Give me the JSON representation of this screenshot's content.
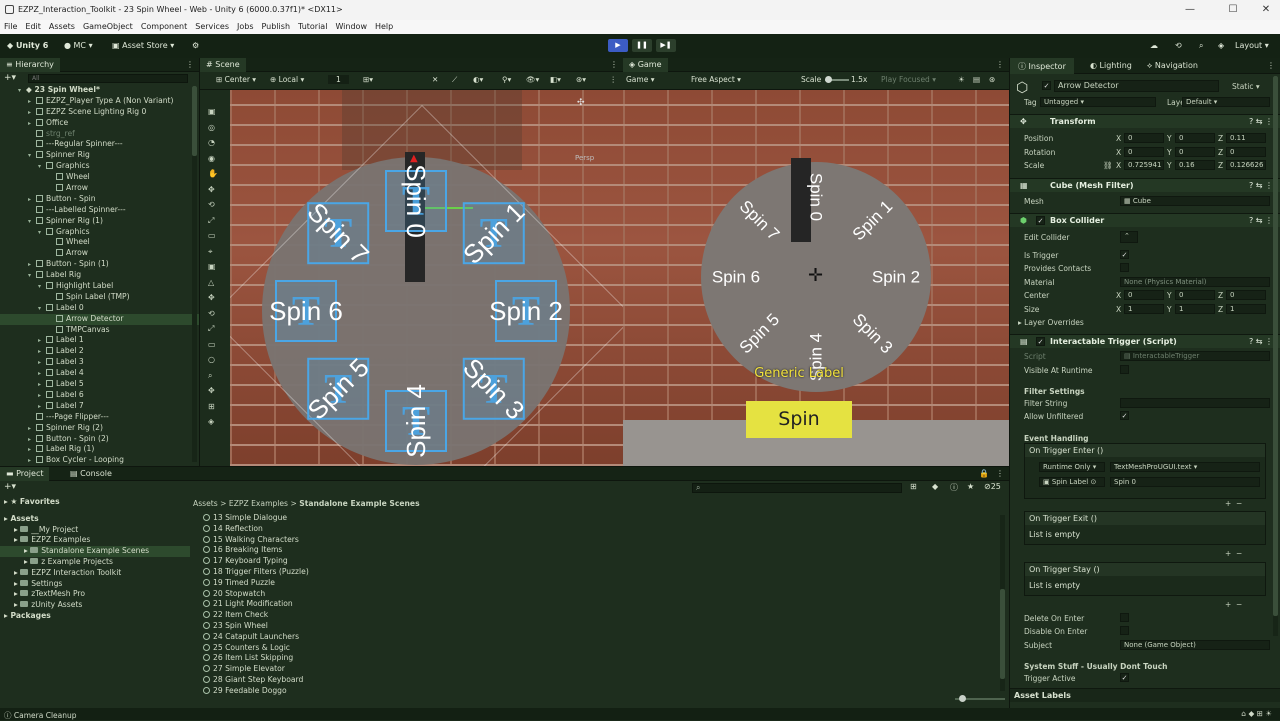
{
  "window": {
    "title": "EZPZ_Interaction_Toolkit - 23 Spin Wheel - Web - Unity 6 (6000.0.37f1)* <DX11>",
    "minimize": "—",
    "maximize": "☐",
    "close": "✕"
  },
  "menu": [
    "File",
    "Edit",
    "Assets",
    "GameObject",
    "Component",
    "Services",
    "Jobs",
    "Publish",
    "Tutorial",
    "Window",
    "Help"
  ],
  "toolbar": {
    "unity": "Unity 6",
    "account": "MC",
    "asset_store": "Asset Store",
    "layout": "Layout"
  },
  "hierarchy": {
    "tab": "Hierarchy",
    "search_placeholder": "All",
    "root": "23 Spin Wheel*",
    "rows": [
      {
        "label": "EZPZ_Player Type A (Non Variant)",
        "indent": 1,
        "arrow": "▸"
      },
      {
        "label": "EZPZ Scene Lighting Rig 0",
        "indent": 1,
        "arrow": "▸"
      },
      {
        "label": "Office",
        "indent": 1,
        "arrow": "▸"
      },
      {
        "label": "strg_ref",
        "indent": 1,
        "arrow": "",
        "dim": true
      },
      {
        "label": "---Regular Spinner---",
        "indent": 1,
        "arrow": ""
      },
      {
        "label": "Spinner Rig",
        "indent": 1,
        "arrow": "▾"
      },
      {
        "label": "Graphics",
        "indent": 2,
        "arrow": "▾"
      },
      {
        "label": "Wheel",
        "indent": 3,
        "arrow": ""
      },
      {
        "label": "Arrow",
        "indent": 3,
        "arrow": ""
      },
      {
        "label": "Button - Spin",
        "indent": 1,
        "arrow": "▸"
      },
      {
        "label": "---Labelled Spinner---",
        "indent": 1,
        "arrow": ""
      },
      {
        "label": "Spinner Rig (1)",
        "indent": 1,
        "arrow": "▾"
      },
      {
        "label": "Graphics",
        "indent": 2,
        "arrow": "▾"
      },
      {
        "label": "Wheel",
        "indent": 3,
        "arrow": ""
      },
      {
        "label": "Arrow",
        "indent": 3,
        "arrow": ""
      },
      {
        "label": "Button - Spin (1)",
        "indent": 1,
        "arrow": "▸"
      },
      {
        "label": "Label Rig",
        "indent": 1,
        "arrow": "▾"
      },
      {
        "label": "Highlight Label",
        "indent": 2,
        "arrow": "▾"
      },
      {
        "label": "Spin Label (TMP)",
        "indent": 3,
        "arrow": ""
      },
      {
        "label": "Label 0",
        "indent": 2,
        "arrow": "▾"
      },
      {
        "label": "Arrow Detector",
        "indent": 3,
        "arrow": "",
        "sel": true
      },
      {
        "label": "TMPCanvas",
        "indent": 3,
        "arrow": ""
      },
      {
        "label": "Label 1",
        "indent": 2,
        "arrow": "▸"
      },
      {
        "label": "Label 2",
        "indent": 2,
        "arrow": "▸"
      },
      {
        "label": "Label 3",
        "indent": 2,
        "arrow": "▸"
      },
      {
        "label": "Label 4",
        "indent": 2,
        "arrow": "▸"
      },
      {
        "label": "Label 5",
        "indent": 2,
        "arrow": "▸"
      },
      {
        "label": "Label 6",
        "indent": 2,
        "arrow": "▸"
      },
      {
        "label": "Label 7",
        "indent": 2,
        "arrow": "▸"
      },
      {
        "label": "---Page Flipper---",
        "indent": 1,
        "arrow": ""
      },
      {
        "label": "Spinner Rig (2)",
        "indent": 1,
        "arrow": "▸"
      },
      {
        "label": "Button - Spin (2)",
        "indent": 1,
        "arrow": "▸"
      },
      {
        "label": "Label Rig (1)",
        "indent": 1,
        "arrow": "▸"
      },
      {
        "label": "Box Cycler - Looping",
        "indent": 1,
        "arrow": "▸"
      }
    ]
  },
  "scene": {
    "tab": "Scene",
    "pivot": "Center",
    "space": "Local",
    "snap": "1",
    "persp": "Persp",
    "labels": [
      "Spin 0",
      "Spin 1",
      "Spin 2",
      "Spin 3",
      "Spin 4",
      "Spin 5",
      "Spin 6",
      "Spin 7"
    ]
  },
  "game": {
    "tab": "Game",
    "mode": "Game",
    "aspect": "Free Aspect",
    "scale_label": "Scale",
    "scale": "1.5x",
    "play": "Play Focused",
    "wheel_labels": [
      "Spin 0",
      "Spin 1",
      "Spin 2",
      "Spin 3",
      "Spin 4",
      "Spin 5",
      "Spin 6",
      "Spin 7"
    ],
    "generic_label": "Generic Label",
    "spin_button": "Spin"
  },
  "inspector": {
    "tabs": [
      "Inspector",
      "Lighting",
      "Navigation"
    ],
    "object_name": "Arrow Detector",
    "static": "Static",
    "tag_label": "Tag",
    "tag": "Untagged",
    "layer_label": "Layer",
    "layer": "Default",
    "transform": {
      "title": "Transform",
      "position_label": "Position",
      "rotation_label": "Rotation",
      "scale_label": "Scale",
      "position": [
        "0",
        "0",
        "0.11"
      ],
      "rotation": [
        "0",
        "0",
        "0"
      ],
      "scale": [
        "0.725941",
        "0.16",
        "0.126626"
      ]
    },
    "mesh_filter": {
      "title": "Cube (Mesh Filter)",
      "mesh_label": "Mesh",
      "mesh": "Cube"
    },
    "box_collider": {
      "title": "Box Collider",
      "edit_collider": "Edit Collider",
      "is_trigger": "Is Trigger",
      "provides_contacts": "Provides Contacts",
      "material_label": "Material",
      "material": "None (Physics Material)",
      "center_label": "Center",
      "center": [
        "0",
        "0",
        "0"
      ],
      "size_label": "Size",
      "size": [
        "1",
        "1",
        "1"
      ],
      "layer_overrides": "Layer Overrides"
    },
    "trigger": {
      "title": "Interactable Trigger (Script)",
      "script_label": "Script",
      "script": "InteractableTrigger",
      "visible_at_runtime": "Visible At Runtime",
      "filter_settings": "Filter Settings",
      "filter_string": "Filter String",
      "allow_unfiltered": "Allow Unfiltered",
      "event_handling": "Event Handling",
      "on_enter": "On Trigger Enter ()",
      "runtime": "Runtime Only",
      "func": "TextMeshProUGUI.text",
      "target": "Spin Label",
      "arg": "Spin 0",
      "on_exit": "On Trigger Exit ()",
      "empty1": "List is empty",
      "on_stay": "On Trigger Stay ()",
      "empty2": "List is empty",
      "delete_on_enter": "Delete On Enter",
      "disable_on_enter": "Disable On Enter",
      "subject_label": "Subject",
      "subject": "None (Game Object)",
      "system_stuff": "System Stuff - Usually Dont Touch",
      "trigger_active": "Trigger Active"
    },
    "asset_labels": "Asset Labels"
  },
  "project": {
    "tabs": [
      "Project",
      "Console"
    ],
    "favorites": "Favorites",
    "tree": [
      {
        "label": "Assets",
        "indent": 0,
        "bold": true
      },
      {
        "label": "__My Project",
        "indent": 1
      },
      {
        "label": "EZPZ Examples",
        "indent": 1
      },
      {
        "label": "Standalone Example Scenes",
        "indent": 2,
        "sel": true
      },
      {
        "label": "z Example Projects",
        "indent": 2
      },
      {
        "label": "EZPZ Interaction Toolkit",
        "indent": 1
      },
      {
        "label": "Settings",
        "indent": 1
      },
      {
        "label": "zTextMesh Pro",
        "indent": 1
      },
      {
        "label": "zUnity Assets",
        "indent": 1
      },
      {
        "label": "Packages",
        "indent": 0,
        "bold": true
      }
    ],
    "breadcrumb": [
      "Assets",
      "EZPZ Examples",
      "Standalone Example Scenes"
    ],
    "files": [
      "13 Simple Dialogue",
      "14 Reflection",
      "15 Walking Characters",
      "16 Breaking Items",
      "17 Keyboard Typing",
      "18 Trigger Filters (Puzzle)",
      "19 Timed Puzzle",
      "20 Stopwatch",
      "21 Light Modification",
      "22 Item Check",
      "23 Spin Wheel",
      "24 Catapult Launchers",
      "25 Counters & Logic",
      "26 Item List Skipping",
      "27 Simple Elevator",
      "28 Giant Step Keyboard",
      "29 Feedable Doggo"
    ],
    "count": "25"
  },
  "status": {
    "text": "Camera Cleanup"
  }
}
